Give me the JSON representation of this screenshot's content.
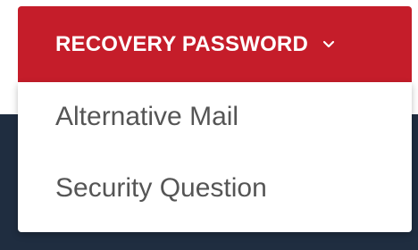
{
  "dropdown": {
    "toggle_label": "RECOVERY PASSWORD",
    "toggle_icon": "chevron-down-icon",
    "items": [
      {
        "label": "Alternative Mail"
      },
      {
        "label": "Security Question"
      }
    ]
  },
  "colors": {
    "toggle_background": "#c51d2a",
    "toggle_text": "#ffffff",
    "menu_background": "#ffffff",
    "menu_text": "#555555",
    "page_backdrop": "#1f2d40"
  }
}
